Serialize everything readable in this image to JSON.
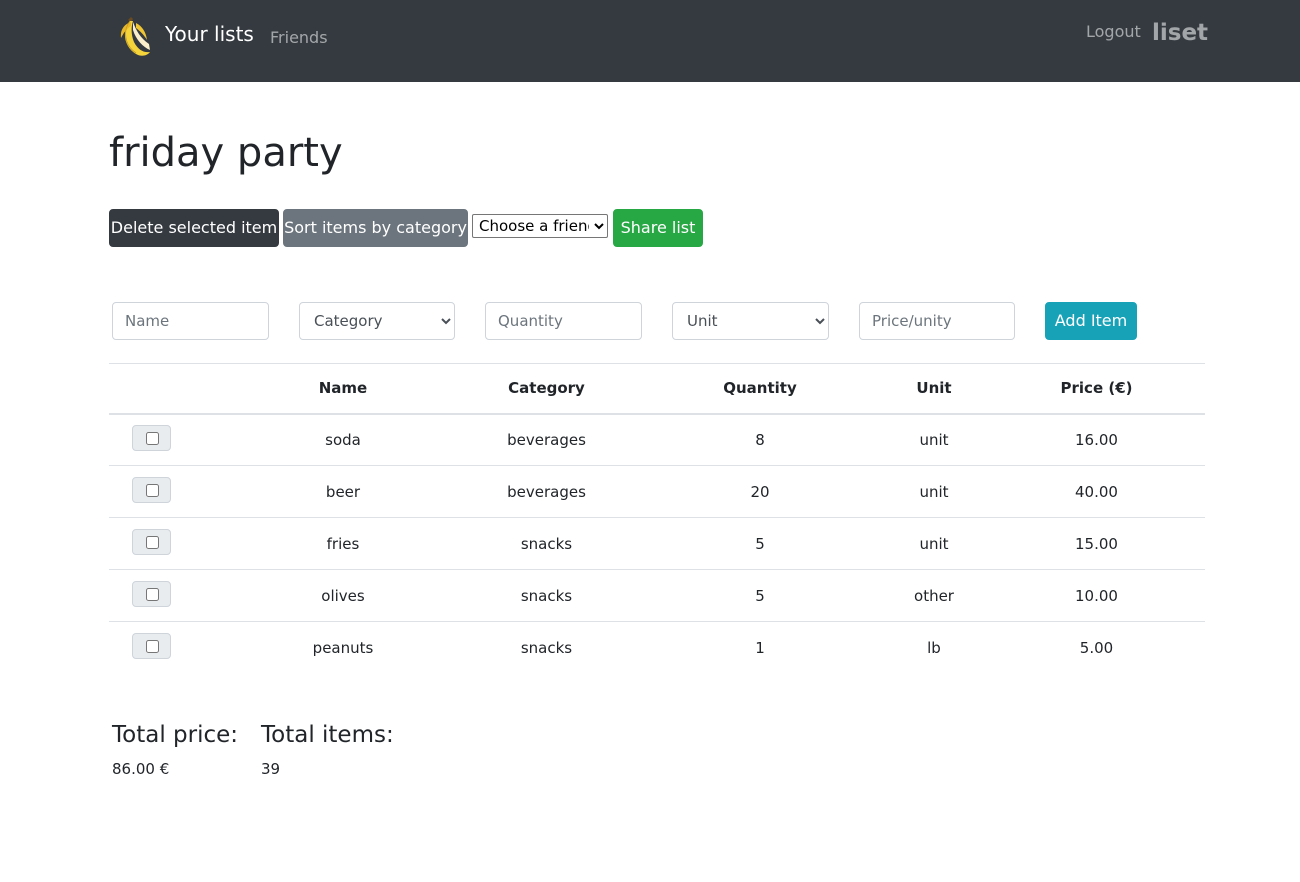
{
  "navbar": {
    "logo_icon": "banana-icon",
    "brand_label": "Your lists",
    "friends_label": "Friends",
    "logout_label": "Logout",
    "username": "liset",
    "bg_color": "#343a40"
  },
  "list": {
    "title": "friday party"
  },
  "toolbar": {
    "delete_label": "Delete selected item",
    "sort_label": "Sort items by category",
    "friend_select_value": "Choose a friend",
    "share_label": "Share list"
  },
  "add_form": {
    "name_placeholder": "Name",
    "category_value": "Category",
    "quantity_placeholder": "Quantity",
    "unit_value": "Unit",
    "price_placeholder": "Price/unity",
    "add_label": "Add Item"
  },
  "table": {
    "headers": {
      "name": "Name",
      "category": "Category",
      "quantity": "Quantity",
      "unit": "Unit",
      "price": "Price (€)"
    },
    "rows": [
      {
        "name": "soda",
        "category": "beverages",
        "quantity": "8",
        "unit": "unit",
        "price": "16.00"
      },
      {
        "name": "beer",
        "category": "beverages",
        "quantity": "20",
        "unit": "unit",
        "price": "40.00"
      },
      {
        "name": "fries",
        "category": "snacks",
        "quantity": "5",
        "unit": "unit",
        "price": "15.00"
      },
      {
        "name": "olives",
        "category": "snacks",
        "quantity": "5",
        "unit": "other",
        "price": "10.00"
      },
      {
        "name": "peanuts",
        "category": "snacks",
        "quantity": "1",
        "unit": "lb",
        "price": "5.00"
      }
    ]
  },
  "totals": {
    "price_label": "Total price:",
    "price_value": "86.00 €",
    "items_label": "Total items:",
    "items_value": "39"
  },
  "colors": {
    "dark": "#343a40",
    "secondary": "#6c757d",
    "success": "#28a745",
    "info": "#17a2b8"
  }
}
